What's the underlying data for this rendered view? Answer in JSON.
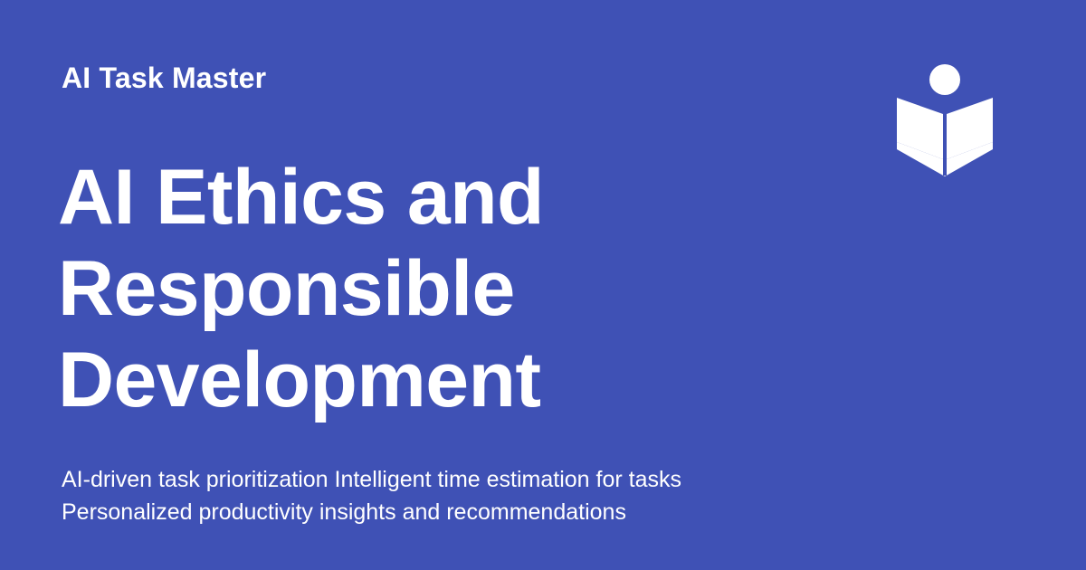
{
  "brand": {
    "name": "AI Task Master"
  },
  "title": {
    "line_1": "AI Ethics and",
    "line_2": "Responsible",
    "line_3": "Development"
  },
  "features": {
    "line_1": "AI-driven task prioritization Intelligent time estimation for tasks",
    "line_2": "Personalized productivity insights and recommendations"
  },
  "logo": {
    "icon": "reader-book-icon"
  },
  "colors": {
    "background": "#3f51b5",
    "text": "#ffffff"
  }
}
